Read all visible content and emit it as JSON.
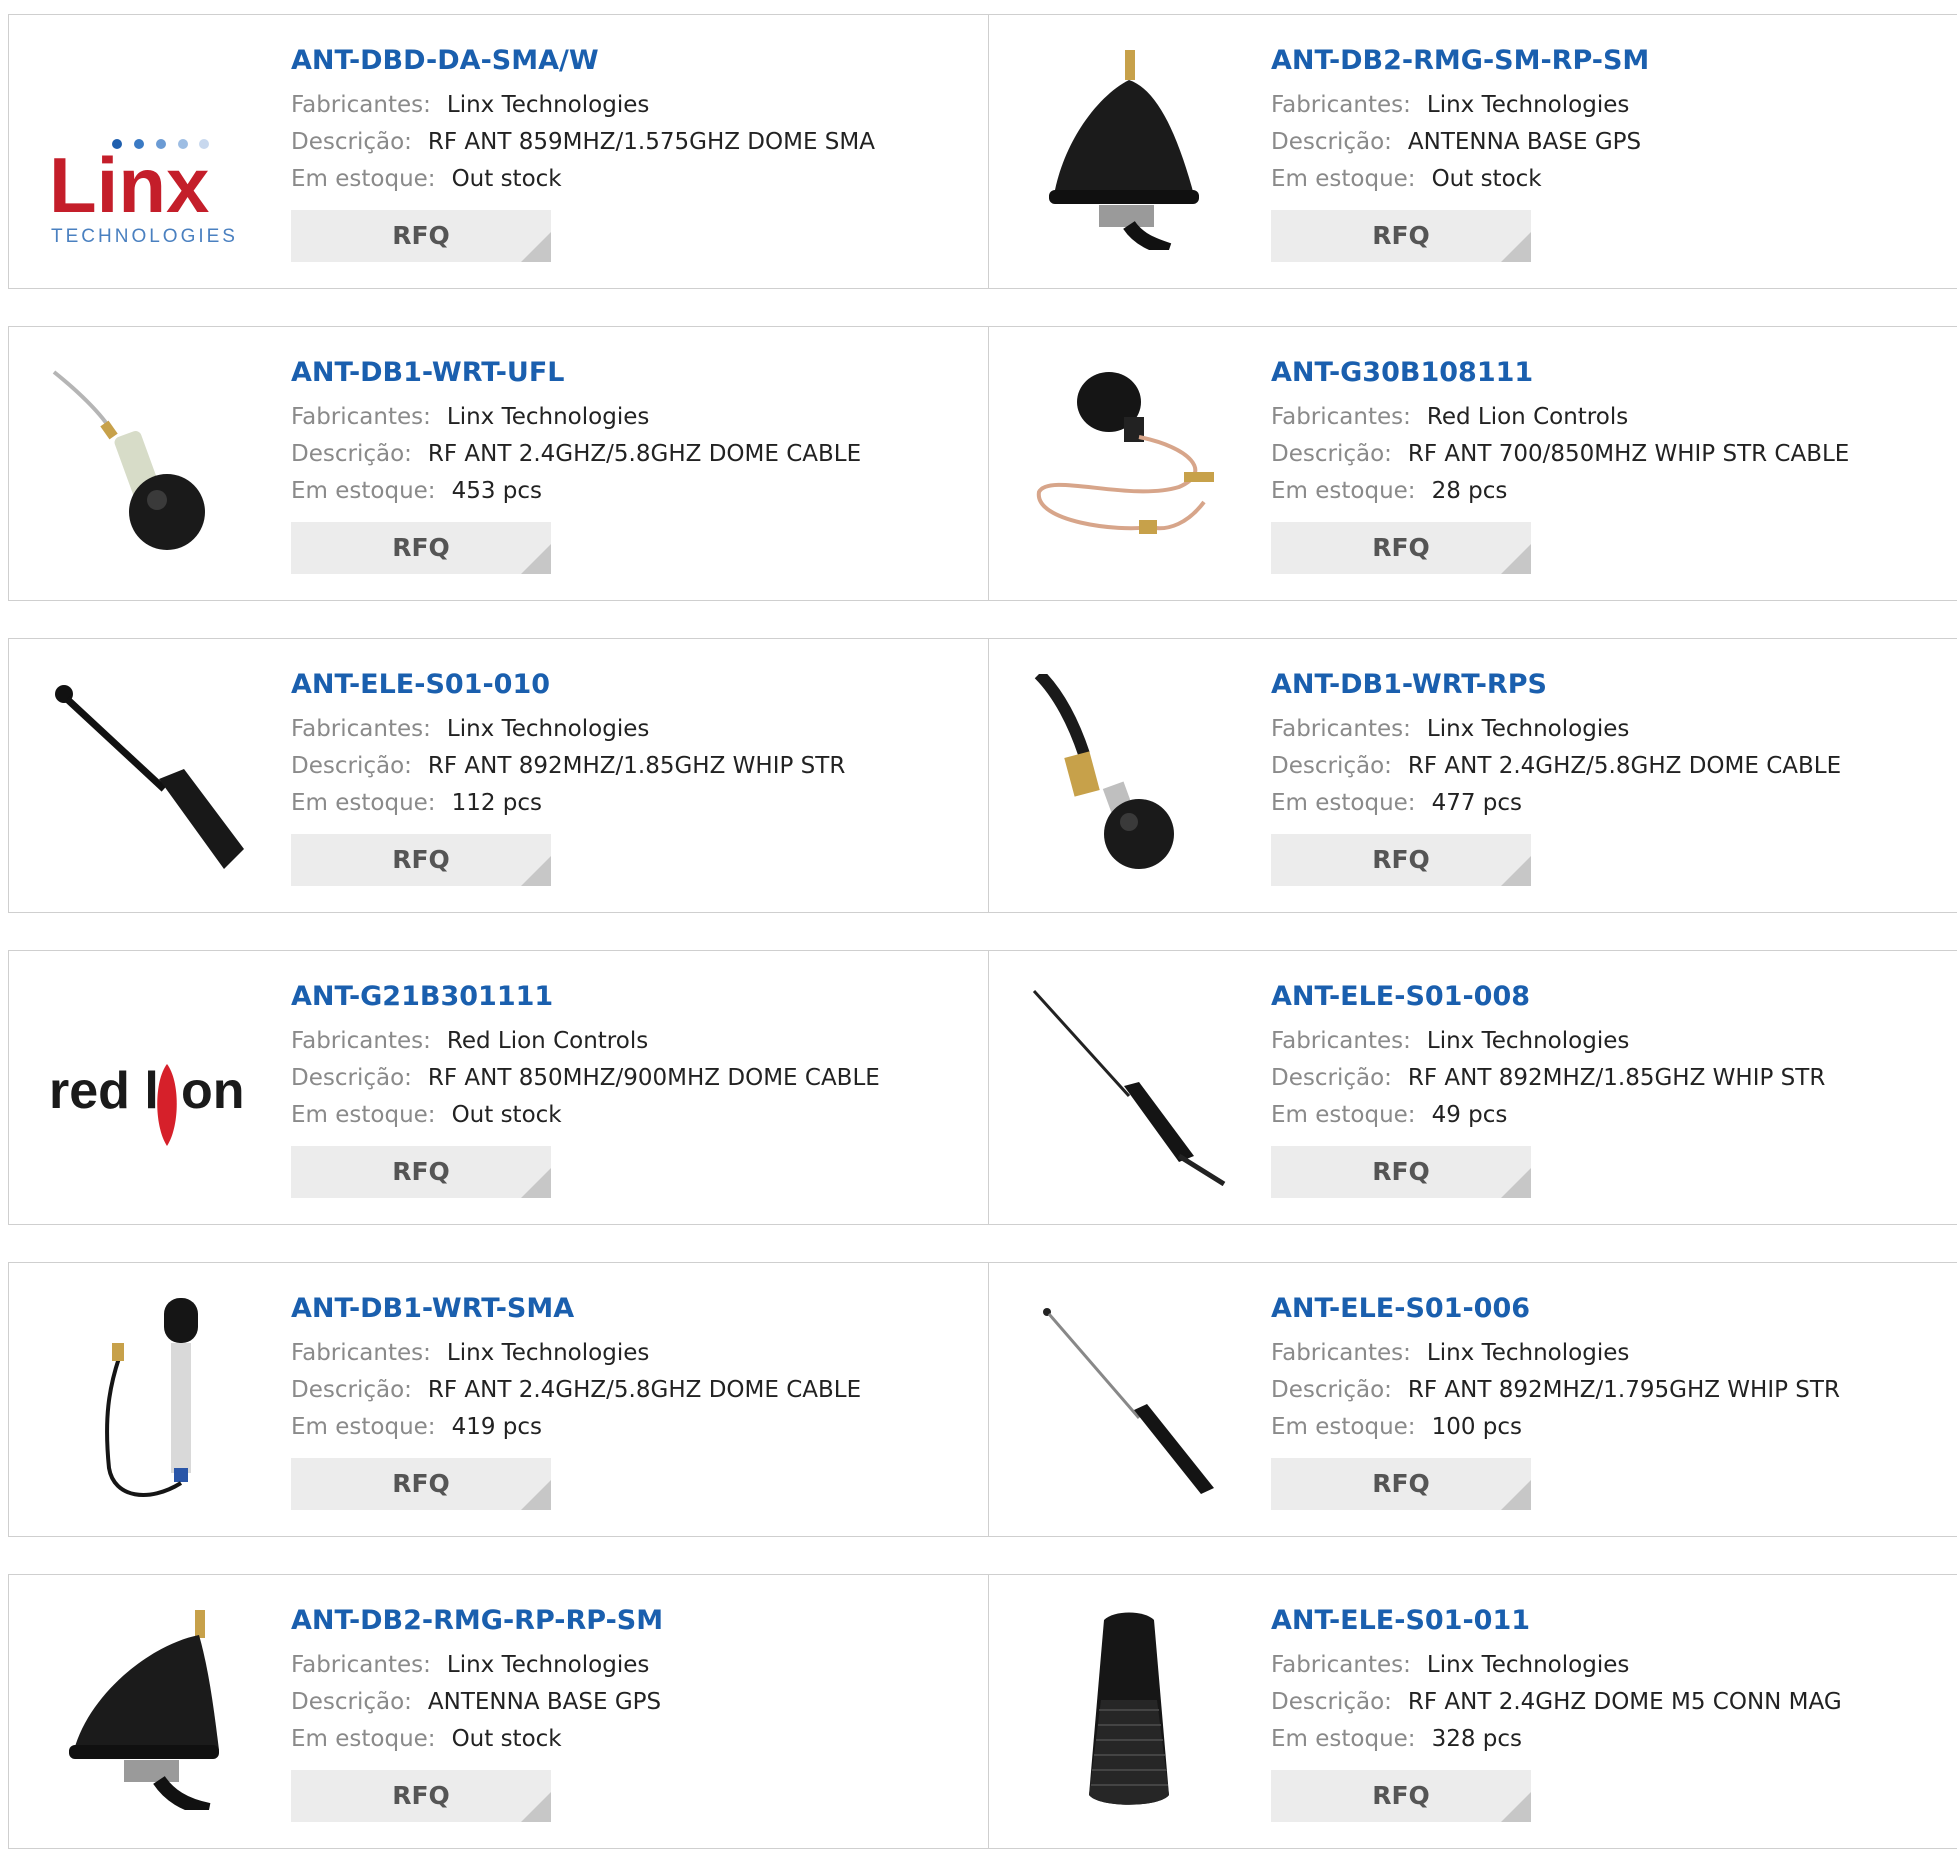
{
  "labels": {
    "manufacturer": "Fabricantes:",
    "description": "Descrição:",
    "stock": "Em estoque:",
    "rfq": "RFQ"
  },
  "colors": {
    "part_number": "#1a5fae",
    "label": "#8a8a8a",
    "button_bg": "#ececec"
  },
  "products": [
    {
      "part": "ANT-DBD-DA-SMA/W",
      "manufacturer": "Linx Technologies",
      "description": "RF ANT 859MHZ/1.575GHZ DOME SMA",
      "stock": "Out stock",
      "image": "linx-logo"
    },
    {
      "part": "ANT-DB2-RMG-SM-RP-SM",
      "manufacturer": "Linx Technologies",
      "description": "ANTENNA BASE GPS",
      "stock": "Out stock",
      "image": "shark-fin-antenna"
    },
    {
      "part": "ANT-DB1-WRT-UFL",
      "manufacturer": "Linx Technologies",
      "description": "RF ANT 2.4GHZ/5.8GHZ DOME CABLE",
      "stock": "453 pcs",
      "image": "dome-antenna-cable"
    },
    {
      "part": "ANT-G30B108111",
      "manufacturer": "Red Lion Controls",
      "description": "RF ANT 700/850MHZ WHIP STR CABLE",
      "stock": "28 pcs",
      "image": "dome-antenna-coiled-cable"
    },
    {
      "part": "ANT-ELE-S01-010",
      "manufacturer": "Linx Technologies",
      "description": "RF ANT 892MHZ/1.85GHZ WHIP STR",
      "stock": "112 pcs",
      "image": "stubby-whip-antenna"
    },
    {
      "part": "ANT-DB1-WRT-RPS",
      "manufacturer": "Linx Technologies",
      "description": "RF ANT 2.4GHZ/5.8GHZ DOME CABLE",
      "stock": "477 pcs",
      "image": "dome-antenna-sma-cable"
    },
    {
      "part": "ANT-G21B301111",
      "manufacturer": "Red Lion Controls",
      "description": "RF ANT 850MHZ/900MHZ DOME CABLE",
      "stock": "Out stock",
      "image": "red-lion-logo"
    },
    {
      "part": "ANT-ELE-S01-008",
      "manufacturer": "Linx Technologies",
      "description": "RF ANT 892MHZ/1.85GHZ WHIP STR",
      "stock": "49 pcs",
      "image": "long-whip-antenna"
    },
    {
      "part": "ANT-DB1-WRT-SMA",
      "manufacturer": "Linx Technologies",
      "description": "RF ANT 2.4GHZ/5.8GHZ DOME CABLE",
      "stock": "419 pcs",
      "image": "pigtail-antenna"
    },
    {
      "part": "ANT-ELE-S01-006",
      "manufacturer": "Linx Technologies",
      "description": "RF ANT 892MHZ/1.795GHZ WHIP STR",
      "stock": "100 pcs",
      "image": "telescopic-whip-antenna"
    },
    {
      "part": "ANT-DB2-RMG-RP-RP-SM",
      "manufacturer": "Linx Technologies",
      "description": "ANTENNA BASE GPS",
      "stock": "Out stock",
      "image": "shark-fin-antenna"
    },
    {
      "part": "ANT-ELE-S01-011",
      "manufacturer": "Linx Technologies",
      "description": "RF ANT 2.4GHZ DOME M5 CONN MAG",
      "stock": "328 pcs",
      "image": "knurled-stubby-antenna"
    }
  ],
  "logo_text": {
    "linx": "Linx",
    "linx_sub": "TECHNOLOGIES",
    "redlion_a": "red l",
    "redlion_b": "on"
  }
}
